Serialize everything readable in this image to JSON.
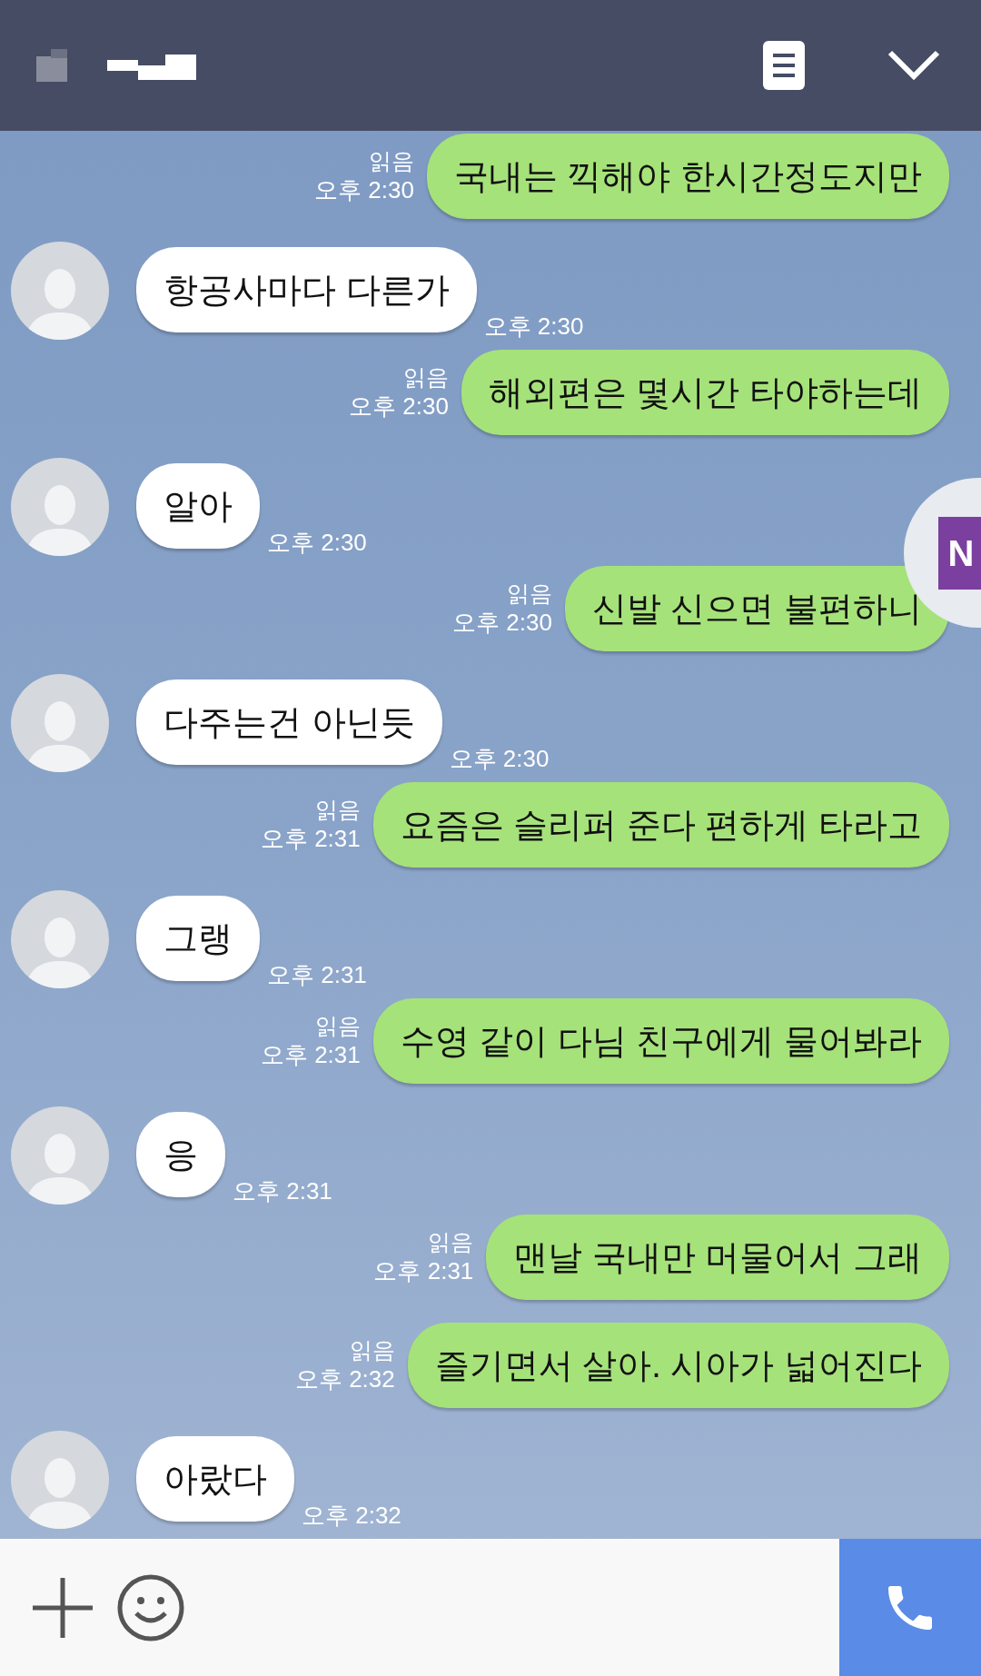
{
  "messages": [
    {
      "kind": "out",
      "text": "국내는 끽해야 한시간정도지만",
      "read": "읽음",
      "time": "오후 2:30"
    },
    {
      "kind": "in",
      "text": "항공사마다 다른가",
      "time": "오후 2:30"
    },
    {
      "kind": "out",
      "text": "해외편은 몇시간 타야하는데",
      "read": "읽음",
      "time": "오후 2:30"
    },
    {
      "kind": "in",
      "text": "알아",
      "time": "오후 2:30"
    },
    {
      "kind": "out",
      "text": "신발 신으면 불편하니",
      "read": "읽음",
      "time": "오후 2:30"
    },
    {
      "kind": "in",
      "text": "다주는건 아닌듯",
      "time": "오후 2:30"
    },
    {
      "kind": "out",
      "text": "요즘은 슬리퍼 준다 편하게 타라고",
      "read": "읽음",
      "time": "오후 2:31"
    },
    {
      "kind": "in",
      "text": "그랭",
      "time": "오후 2:31"
    },
    {
      "kind": "out",
      "text": "수영 같이 다님 친구에게 물어봐라",
      "read": "읽음",
      "time": "오후 2:31"
    },
    {
      "kind": "in",
      "text": "응",
      "time": "오후 2:31"
    },
    {
      "kind": "out",
      "text": "맨날 국내만 머물어서 그래",
      "read": "읽음",
      "time": "오후 2:31"
    },
    {
      "kind": "out",
      "text": "즐기면서 살아. 시아가 넓어진다",
      "read": "읽음",
      "time": "오후 2:32"
    },
    {
      "kind": "in",
      "text": "아랐다",
      "time": "오후 2:32"
    }
  ],
  "floating_badge": {
    "label": "N"
  }
}
